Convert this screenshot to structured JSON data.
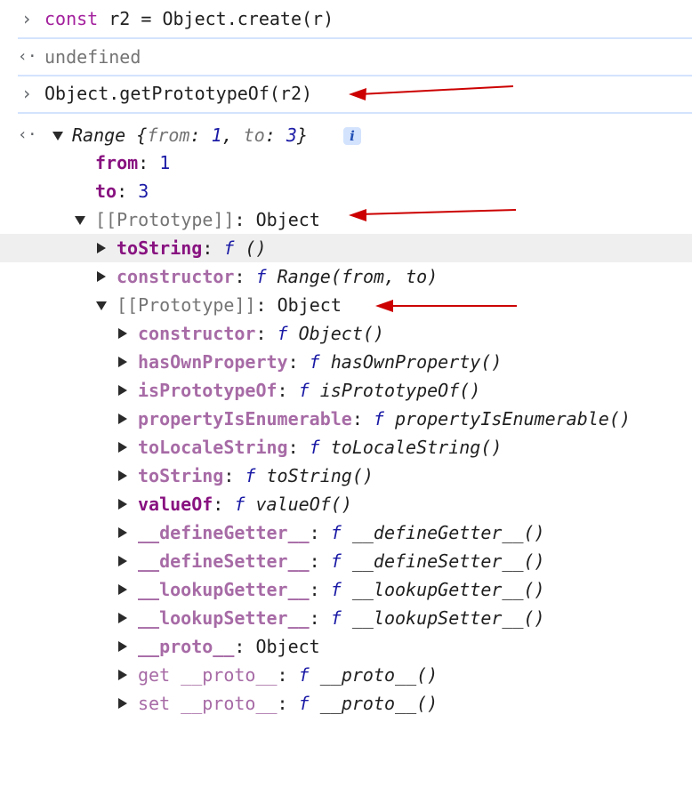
{
  "console": {
    "input1": {
      "keyword": "const",
      "rest": " r2 = Object.create(r)"
    },
    "output1": "undefined",
    "input2": "Object.getPrototypeOf(r2)",
    "range_summary": {
      "name": "Range",
      "open": " {",
      "from_key": "from",
      "colon": ": ",
      "from_val": "1",
      "comma": ", ",
      "to_key": "to",
      "to_val": "3",
      "close": "}",
      "info": "i"
    },
    "own_props": [
      {
        "key": "from",
        "value": "1"
      },
      {
        "key": "to",
        "value": "3"
      }
    ],
    "proto1": {
      "label": "[[Prototype]]",
      "value": "Object",
      "items": [
        {
          "key": "toString",
          "f": "f",
          "sig": "()"
        },
        {
          "key": "constructor",
          "f": "f",
          "sig": "Range(from, to)"
        }
      ]
    },
    "proto2": {
      "label": "[[Prototype]]",
      "value": "Object",
      "items": [
        {
          "key": "constructor",
          "f": "f",
          "sig": "Object()"
        },
        {
          "key": "hasOwnProperty",
          "f": "f",
          "sig": "hasOwnProperty()"
        },
        {
          "key": "isPrototypeOf",
          "f": "f",
          "sig": "isPrototypeOf()"
        },
        {
          "key": "propertyIsEnumerable",
          "f": "f",
          "sig": "propertyIsEnumerable()"
        },
        {
          "key": "toLocaleString",
          "f": "f",
          "sig": "toLocaleString()"
        },
        {
          "key": "toString",
          "f": "f",
          "sig": "toString()"
        },
        {
          "key": "valueOf",
          "f": "f",
          "sig": "valueOf()"
        },
        {
          "key": "__defineGetter__",
          "f": "f",
          "sig": "__defineGetter__()"
        },
        {
          "key": "__defineSetter__",
          "f": "f",
          "sig": "__defineSetter__()"
        },
        {
          "key": "__lookupGetter__",
          "f": "f",
          "sig": "__lookupGetter__()"
        },
        {
          "key": "__lookupSetter__",
          "f": "f",
          "sig": "__lookupSetter__()"
        }
      ],
      "proto_item": {
        "key": "__proto__",
        "value": "Object"
      },
      "accessors": [
        {
          "prefix": "get",
          "key": "__proto__",
          "f": "f",
          "sig": "__proto__()"
        },
        {
          "prefix": "set",
          "key": "__proto__",
          "f": "f",
          "sig": "__proto__()"
        }
      ]
    },
    "colors": {
      "arrow": "#cc0000",
      "separator": "#d3e3fd",
      "keyword": "#a3209d",
      "property": "#881280",
      "inherited_property": "#a76ba6",
      "number": "#1a1aa6"
    },
    "icons": {
      "prompt": "chevron-right-icon",
      "result": "result-arrow-icon",
      "expand": "triangle-down-icon",
      "collapse": "triangle-right-icon",
      "info": "info-icon"
    }
  }
}
